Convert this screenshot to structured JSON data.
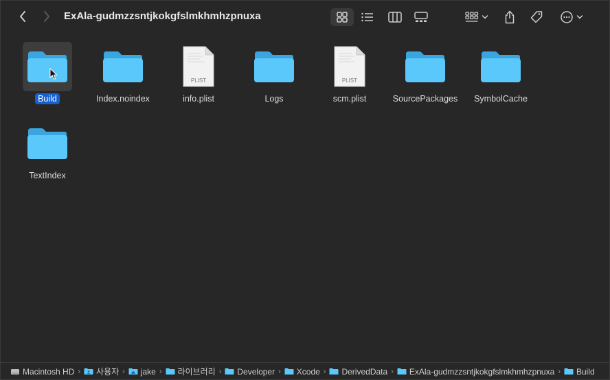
{
  "window": {
    "title": "ExAla-gudmzzsntjkokgfslmkhmhzpnuxa"
  },
  "toolbar": {
    "back_icon": "chevron-left-icon",
    "forward_icon": "chevron-right-icon",
    "view_icons": [
      "icon-view-icon",
      "list-view-icon",
      "column-view-icon",
      "gallery-view-icon"
    ],
    "group_icon": "group-by-icon",
    "share_icon": "share-icon",
    "tag_icon": "tag-icon",
    "more_icon": "more-icon"
  },
  "items": [
    {
      "label": "Build",
      "type": "folder",
      "selected": true
    },
    {
      "label": "Index.noindex",
      "type": "folder"
    },
    {
      "label": "info.plist",
      "type": "file",
      "badge": "PLIST"
    },
    {
      "label": "Logs",
      "type": "folder"
    },
    {
      "label": "scm.plist",
      "type": "file",
      "badge": "PLIST"
    },
    {
      "label": "SourcePackages",
      "type": "folder"
    },
    {
      "label": "SymbolCache",
      "type": "folder"
    },
    {
      "label": "TextIndex",
      "type": "folder"
    }
  ],
  "pathbar": {
    "crumbs": [
      "Macintosh HD",
      "사용자",
      "jake",
      "라이브러리",
      "Developer",
      "Xcode",
      "DerivedData",
      "ExAla-gudmzzsntjkokgfslmkhmhzpnuxa",
      "Build"
    ],
    "separator": "›"
  },
  "colors": {
    "background": "#272727",
    "folder": "#5ac8fa",
    "folder_dark": "#3aa5de",
    "selection": "#1660d0"
  }
}
